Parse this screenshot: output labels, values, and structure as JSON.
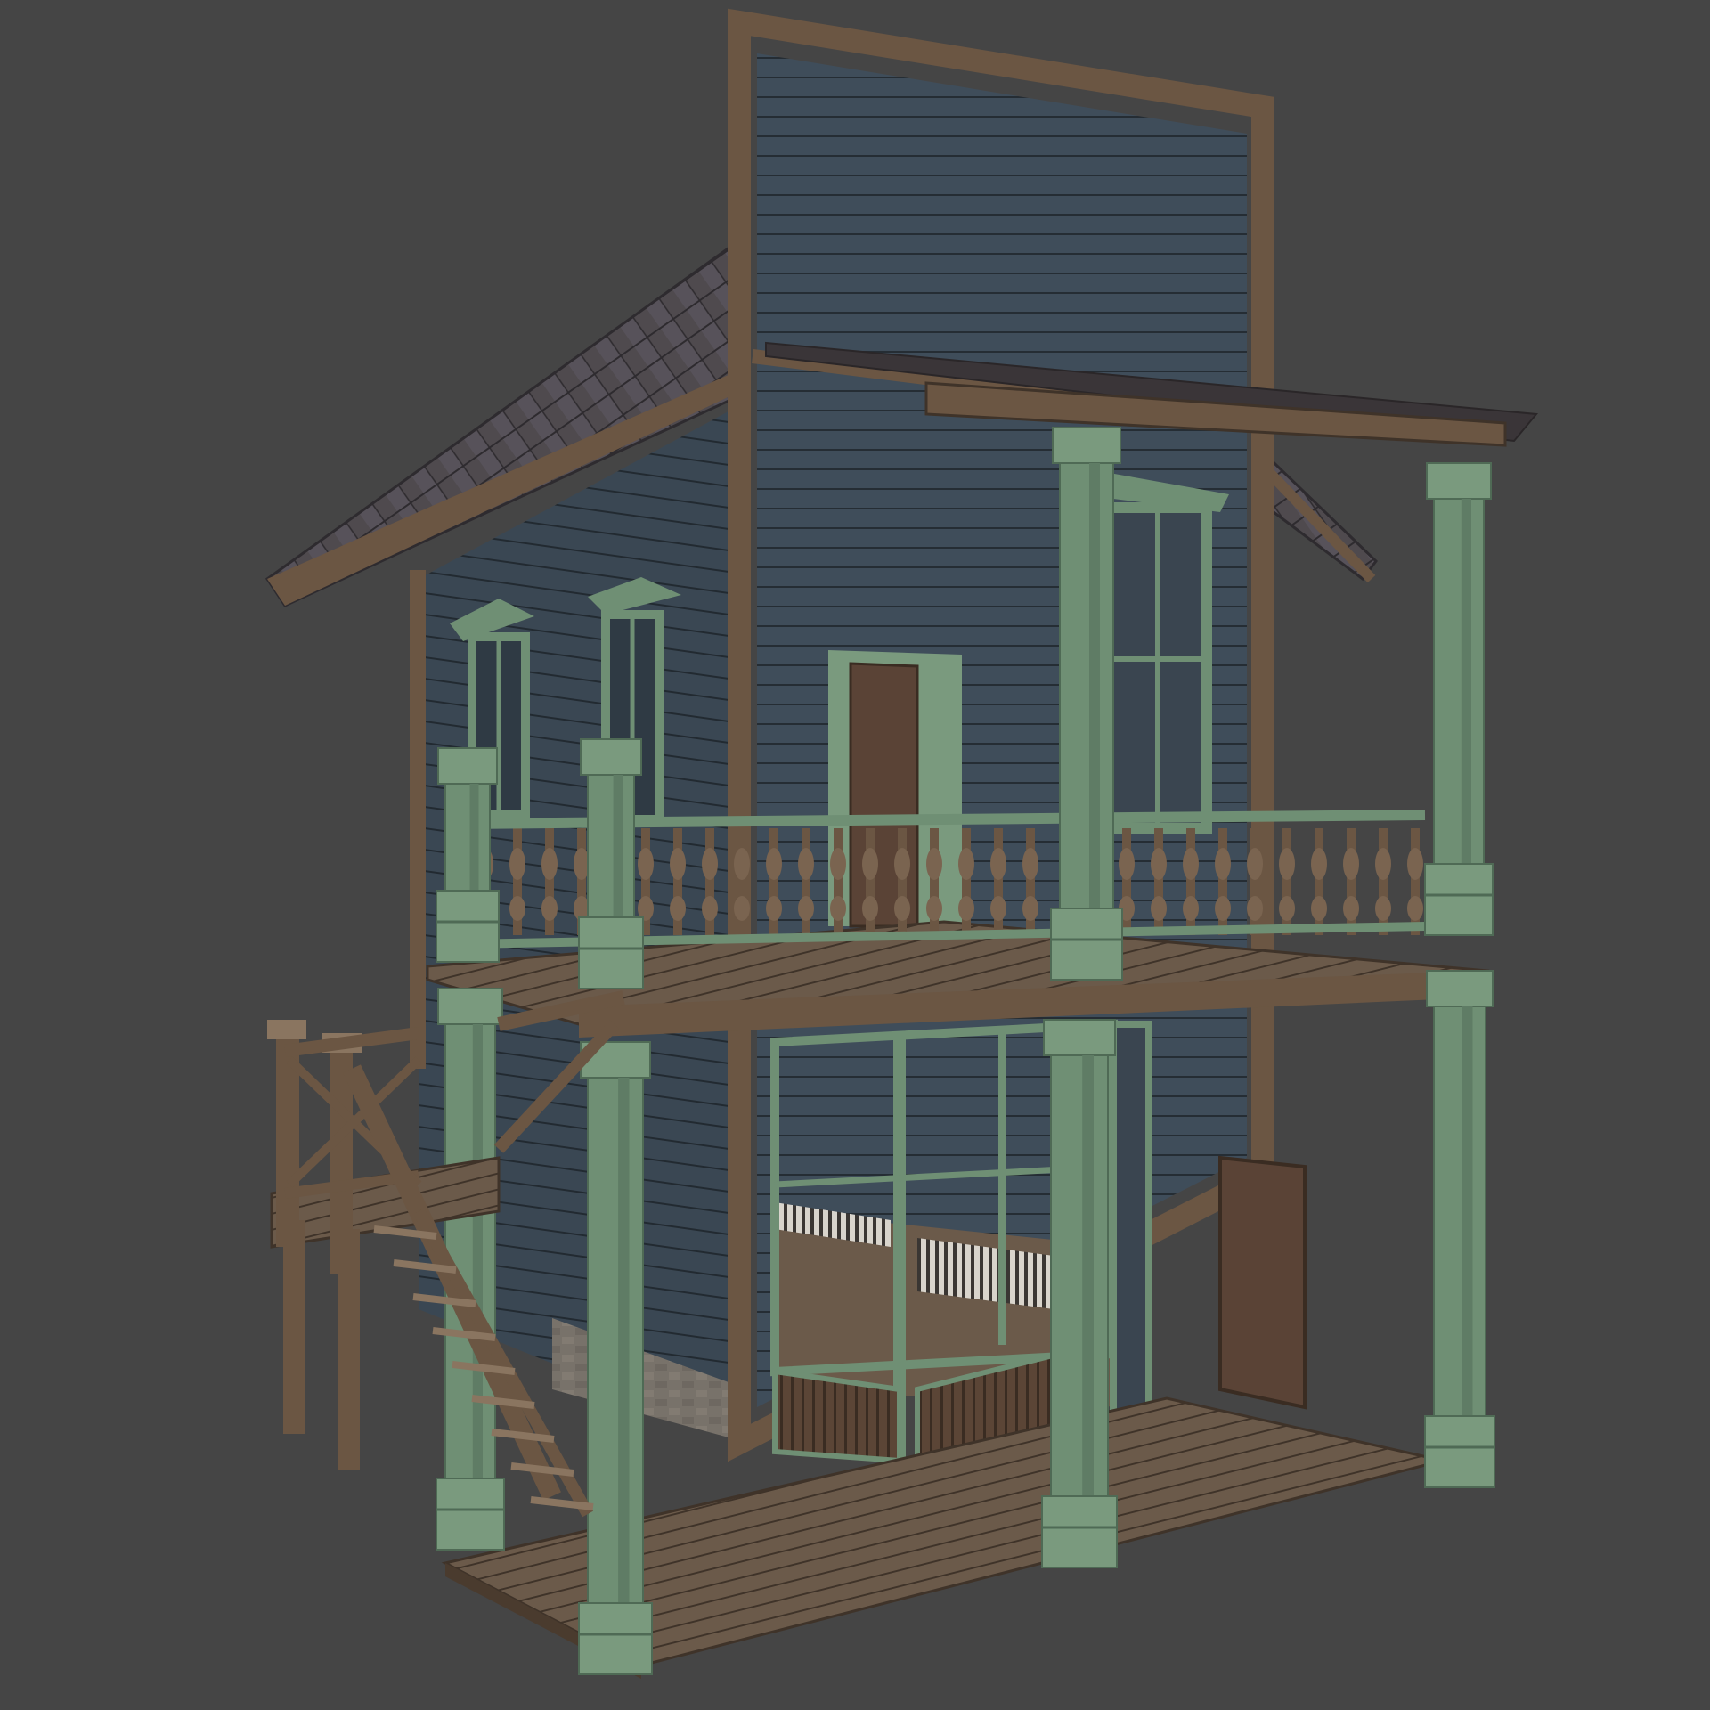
{
  "viewport": {
    "background": "#454545"
  },
  "model": {
    "palette": {
      "siding": "#3f4d5a",
      "siding_line": "#2a333b",
      "wood": "#6b5643",
      "wood_dark": "#4a3b2e",
      "wood_light": "#8a7560",
      "trim_green": "#6f8f74",
      "trim_green_dark": "#4f6a55",
      "roof": "#4f4a4e",
      "door": "#5a4336",
      "glass": "#3a4550",
      "stone": "#7a746c"
    }
  }
}
